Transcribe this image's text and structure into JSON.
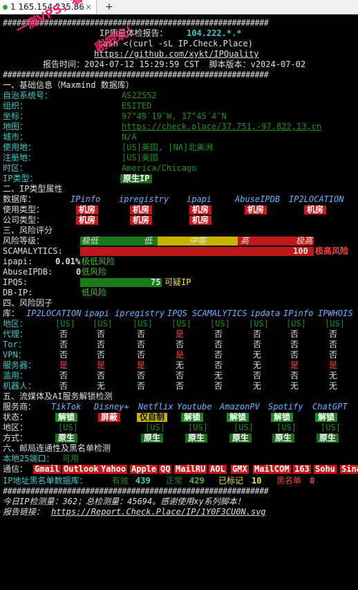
{
  "tab": {
    "title": "1 165.154.235.86",
    "close": "×",
    "add": "+"
  },
  "header": {
    "hash_line": "##########################################################",
    "title_prefix": "IP质量体检报告：",
    "title_ip": "104.222.*.*",
    "cmd": "bash <(curl -sL IP.Check.Place)",
    "url": "https://github.com/xykt/IPQuality",
    "time_line": "报告时间：2024-07-12 15:29:59 CST  脚本版本：v2024-07-02"
  },
  "watermark": {
    "line1": "一测VPS，看以我玩",
    "line2": "剧把玩！"
  },
  "sec1": {
    "title": "一、基础信息（Maxmind 数据库）",
    "rows": [
      {
        "k": "自治系统号：",
        "v": "AS22552"
      },
      {
        "k": "组织：",
        "v": "ESITED"
      },
      {
        "k": "坐标：",
        "v": "97°49′19″W, 37°45′4″N"
      },
      {
        "k": "地图：",
        "v": "https://check.place/37.751,-97.822,13,cn"
      },
      {
        "k": "城市：",
        "v": "N/A"
      },
      {
        "k": "使用地：",
        "v": "[US]美国, [NA]北美洲"
      },
      {
        "k": "注册地：",
        "v": "[US]美国"
      },
      {
        "k": "时区：",
        "v": "America/Chicago"
      },
      {
        "k": "IP类型：",
        "v": "原生IP"
      }
    ]
  },
  "sec2": {
    "title": "二、IP类型属性",
    "db_label": "数据库：",
    "dbs": [
      "IPinfo",
      "ipregistry",
      "ipapi",
      "AbuseIPDB",
      "IP2LOCATION"
    ],
    "use_label": "使用类型：",
    "use": [
      "机房",
      "机房",
      "机房",
      "机房",
      "机房"
    ],
    "com_label": "公司类型：",
    "com": [
      "机房",
      "机房",
      "机房"
    ]
  },
  "sec3": {
    "title": "三、风险评分",
    "level_label": "风险等级：",
    "levels": [
      "极低",
      "低",
      "中等",
      "高",
      "极高"
    ],
    "scam_label": "SCAMALYTICS:",
    "scam_value": "100",
    "scam_text": "极高风险",
    "ipapi_label": "ipapi:",
    "ipapi_value": "0.01%",
    "ipapi_text": "极低风险",
    "abuse_label": "AbuseIPDB:",
    "abuse_value": "0",
    "abuse_text": "低风险",
    "ipqs_label": "IPQS:",
    "ipqs_value": "75",
    "ipqs_text": "可疑IP",
    "dbip_label": "DB-IP:",
    "dbip_text": "低风险"
  },
  "sec4": {
    "title": "四、风险因子",
    "lib_label": "库：",
    "cols": [
      "IP2LOCATION",
      "ipapi",
      "ipregistry",
      "IPQS",
      "SCAMALYTICS",
      "ipdata",
      "IPinfo",
      "IPWHOIS"
    ],
    "rows": [
      {
        "k": "地区：",
        "v": [
          "[US]",
          "[US]",
          "[US]",
          "[US]",
          "[US]",
          "[US]",
          "[US]",
          "[US]"
        ]
      },
      {
        "k": "代理：",
        "v": [
          "否",
          "否",
          "否",
          "是",
          "否",
          "否",
          "否",
          "否"
        ]
      },
      {
        "k": "Tor：",
        "v": [
          "否",
          "否",
          "否",
          "否",
          "否",
          "否",
          "否",
          "否"
        ]
      },
      {
        "k": "VPN：",
        "v": [
          "否",
          "否",
          "否",
          "是",
          "否",
          "无",
          "否",
          "否"
        ]
      },
      {
        "k": "服务器：",
        "v": [
          "是",
          "是",
          "是",
          "无",
          "否",
          "无",
          "是",
          "是"
        ]
      },
      {
        "k": "滥用：",
        "v": [
          "否",
          "否",
          "否",
          "否",
          "无",
          "否",
          "否",
          "无"
        ]
      },
      {
        "k": "机器人：",
        "v": [
          "否",
          "无",
          "否",
          "否",
          "否",
          "无",
          "无",
          "无"
        ]
      }
    ]
  },
  "sec5": {
    "title": "五、流媒体及AI服务解锁检测",
    "svc_label": "服务商：",
    "services": [
      "TikTok",
      "Disney+",
      "Netflix",
      "Youtube",
      "AmazonPV",
      "Spotify",
      "ChatGPT"
    ],
    "status_label": "状态：",
    "status": [
      "解锁",
      "屏蔽",
      "仅自制",
      "解锁",
      "解锁",
      "解锁",
      "解锁"
    ],
    "region_label": "地区：",
    "region": [
      "[US]",
      "",
      "[US]",
      "[US]",
      "[US]",
      "[US]",
      "[US]"
    ],
    "mode_label": "方式：",
    "mode": [
      "原生",
      "",
      "原生",
      "原生",
      "原生",
      "原生",
      "原生"
    ]
  },
  "sec6": {
    "title": "六、邮局连通性及黑名单检测",
    "port_label": "本地25端口：",
    "port_value": "可用",
    "mail_label": "通信：",
    "mail": [
      "Gmail",
      "Outlook",
      "Yahoo",
      "Apple",
      "QQ",
      "MailRU",
      "AOL",
      "GMX",
      "MailCOM",
      "163",
      "Sohu",
      "Sina"
    ],
    "bl_label": "IP地址黑名单数据库：",
    "bl_valid_label": "有效",
    "bl_valid": "439",
    "bl_ok_label": "正常",
    "bl_ok": "429",
    "bl_marked_label": "已标记",
    "bl_marked": "10",
    "bl_black_label": "黑名单",
    "bl_black": "0"
  },
  "footer": {
    "line": "今日IP检测量：362；总检测量：45694。感谢使用xy系列脚本！",
    "link_label": "报告链接：",
    "link": "https://Report.Check.Place/IP/1Y0F3CU0N.svg"
  }
}
